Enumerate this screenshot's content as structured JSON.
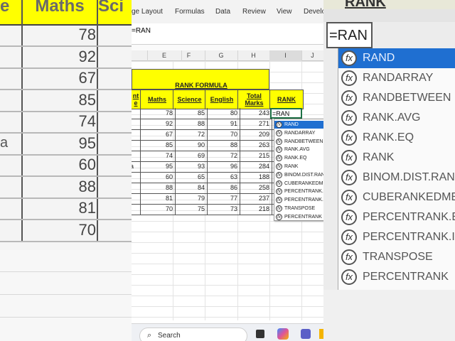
{
  "left_zoom": {
    "headers": [
      "e",
      "Maths",
      "Sci"
    ],
    "values": [
      "78",
      "92",
      "67",
      "85",
      "74",
      "95",
      "60",
      "88",
      "81",
      "70"
    ],
    "row_letter": "a"
  },
  "ribbon": {
    "tabs": [
      "ge Layout",
      "Formulas",
      "Data",
      "Review",
      "View",
      "Develo"
    ]
  },
  "formula_bar": {
    "content": "=RAN"
  },
  "columns": [
    "E",
    "F",
    "G",
    "H",
    "I",
    "J"
  ],
  "table": {
    "title": "RANK FORMULA",
    "headers": {
      "name": "nt\ne",
      "maths": "Maths",
      "science": "Science",
      "english": "English",
      "total": "Total\nMarks",
      "rank": "RANK"
    },
    "rows": [
      {
        "prefix": "",
        "maths": "78",
        "science": "85",
        "english": "80",
        "total": "243"
      },
      {
        "prefix": "",
        "maths": "92",
        "science": "88",
        "english": "91",
        "total": "271"
      },
      {
        "prefix": "",
        "maths": "67",
        "science": "72",
        "english": "70",
        "total": "209"
      },
      {
        "prefix": "",
        "maths": "85",
        "science": "90",
        "english": "88",
        "total": "263"
      },
      {
        "prefix": "",
        "maths": "74",
        "science": "69",
        "english": "72",
        "total": "215"
      },
      {
        "prefix": "a",
        "maths": "95",
        "science": "93",
        "english": "96",
        "total": "284"
      },
      {
        "prefix": "",
        "maths": "60",
        "science": "65",
        "english": "63",
        "total": "188"
      },
      {
        "prefix": "",
        "maths": "88",
        "science": "84",
        "english": "86",
        "total": "258"
      },
      {
        "prefix": "",
        "maths": "81",
        "science": "79",
        "english": "77",
        "total": "237"
      },
      {
        "prefix": "",
        "maths": "70",
        "science": "75",
        "english": "73",
        "total": "218"
      }
    ],
    "active_cell_value": "=RAN"
  },
  "autocomplete": {
    "selected_index": 0,
    "items": [
      "RAND",
      "RANDARRAY",
      "RANDBETWEEN",
      "RANK.AVG",
      "RANK.EQ",
      "RANK",
      "BINOM.DIST.RANGE",
      "CUBERANKEDMEMBER",
      "PERCENTRANK.EXC",
      "PERCENTRANK.INC",
      "TRANSPOSE",
      "PERCENTRANK"
    ],
    "icon_glyph": "fx"
  },
  "right_zoom": {
    "header": "RANK",
    "cell_value": "=RAN",
    "items": [
      "RAND",
      "RANDARRAY",
      "RANDBETWEEN",
      "RANK.AVG",
      "RANK.EQ",
      "RANK",
      "BINOM.DIST.RAN",
      "CUBERANKEDME",
      "PERCENTRANK.E",
      "PERCENTRANK.IN",
      "TRANSPOSE",
      "PERCENTRANK"
    ]
  },
  "taskbar": {
    "search_placeholder": "Search"
  }
}
